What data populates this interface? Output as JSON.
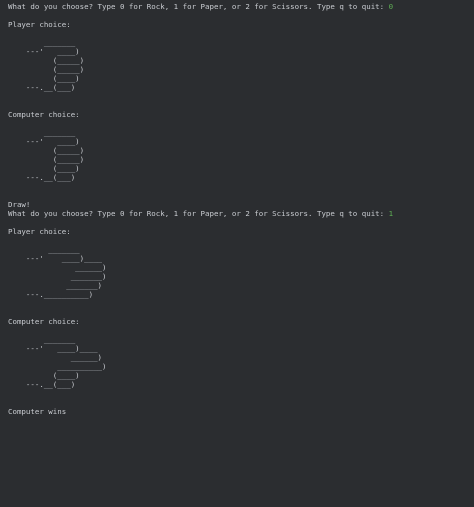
{
  "console": {
    "prompt_text": "What do you choose? Type 0 for Rock, 1 for Paper, or 2 for Scissors. Type q to quit: ",
    "player_label": "Player choice:",
    "computer_label": "Computer choice:",
    "input_color": "#5faf55",
    "rounds": [
      {
        "input": "0",
        "player_art": "        _______\n    ---'   ____)\n          (_____)\n          (_____)\n          (____)\n    ---.__(___)",
        "computer_art": "        _______\n    ---'   ____)\n          (_____)\n          (_____)\n          (____)\n    ---.__(___)",
        "result": "Draw!"
      },
      {
        "input": "1",
        "player_art": "         _______\n    ---'    ____)____\n               ______)\n              _______)\n             _______)\n    ---.__________)",
        "computer_art": "        _______\n    ---'   ____)____\n              ______)\n           __________)\n          (____)\n    ---.__(___)",
        "result": "Computer wins"
      }
    ]
  }
}
